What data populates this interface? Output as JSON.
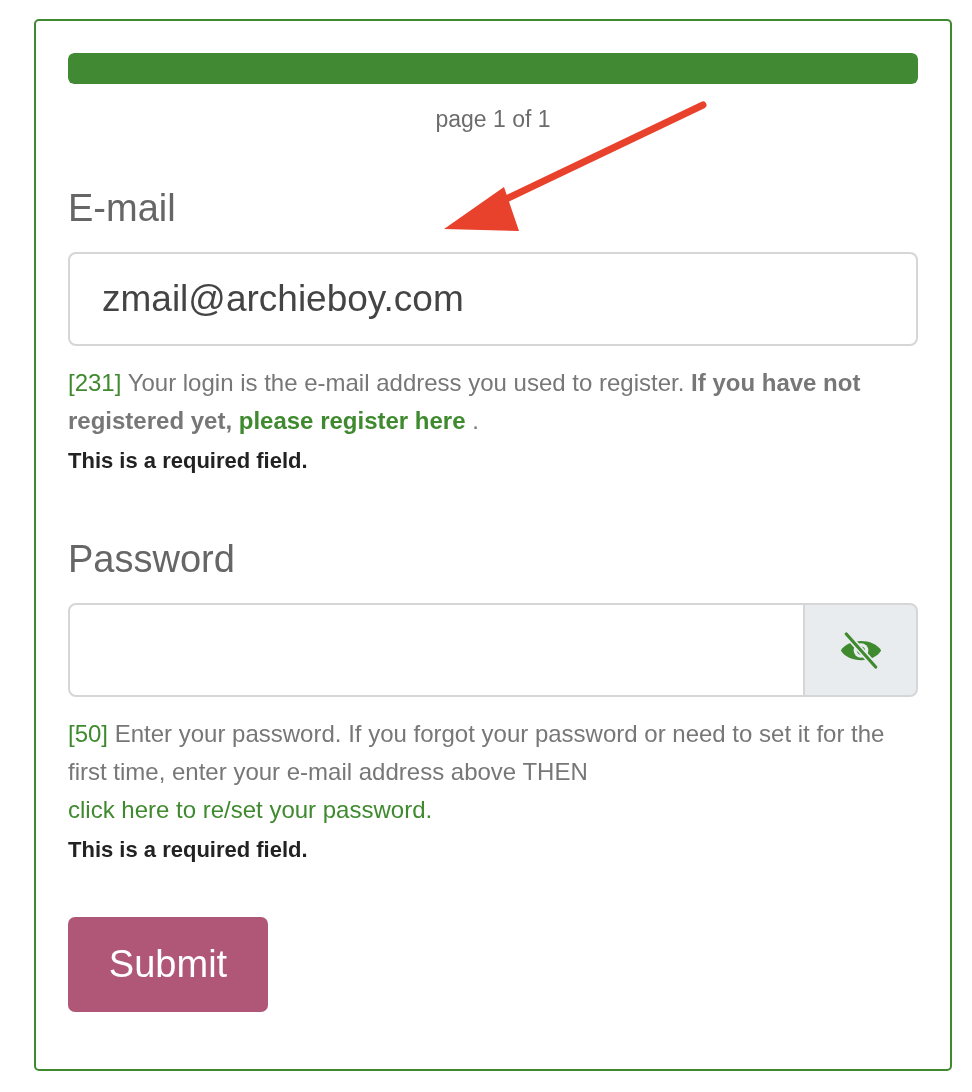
{
  "progress": {
    "level": 1,
    "label": "page 1 of 1"
  },
  "fields": [
    {
      "kind": "email",
      "label": "E-mail",
      "value": "zmail@archieboy.com",
      "help": [
        {
          "kind": "code",
          "text": "[231]"
        },
        {
          "kind": "text",
          "text": " Your login is the e-mail address you used to register. "
        },
        {
          "kind": "bold",
          "text": "If you have not registered yet, "
        },
        {
          "kind": "link",
          "text": "please register here"
        },
        {
          "kind": "text",
          "text": " ."
        }
      ],
      "required": "This is a required field."
    },
    {
      "kind": "password",
      "label": "Password",
      "help": [
        {
          "kind": "code",
          "text": "[50]"
        },
        {
          "kind": "text",
          "text": " Enter your password. If you forgot your password or need to set it for the first time, enter your e-mail address above THEN "
        },
        {
          "kind": "link",
          "text": "click here to re/set your password."
        }
      ],
      "required": "This is a required field."
    }
  ],
  "submit": "Submit",
  "annotation": {
    "kind": "arrow"
  }
}
